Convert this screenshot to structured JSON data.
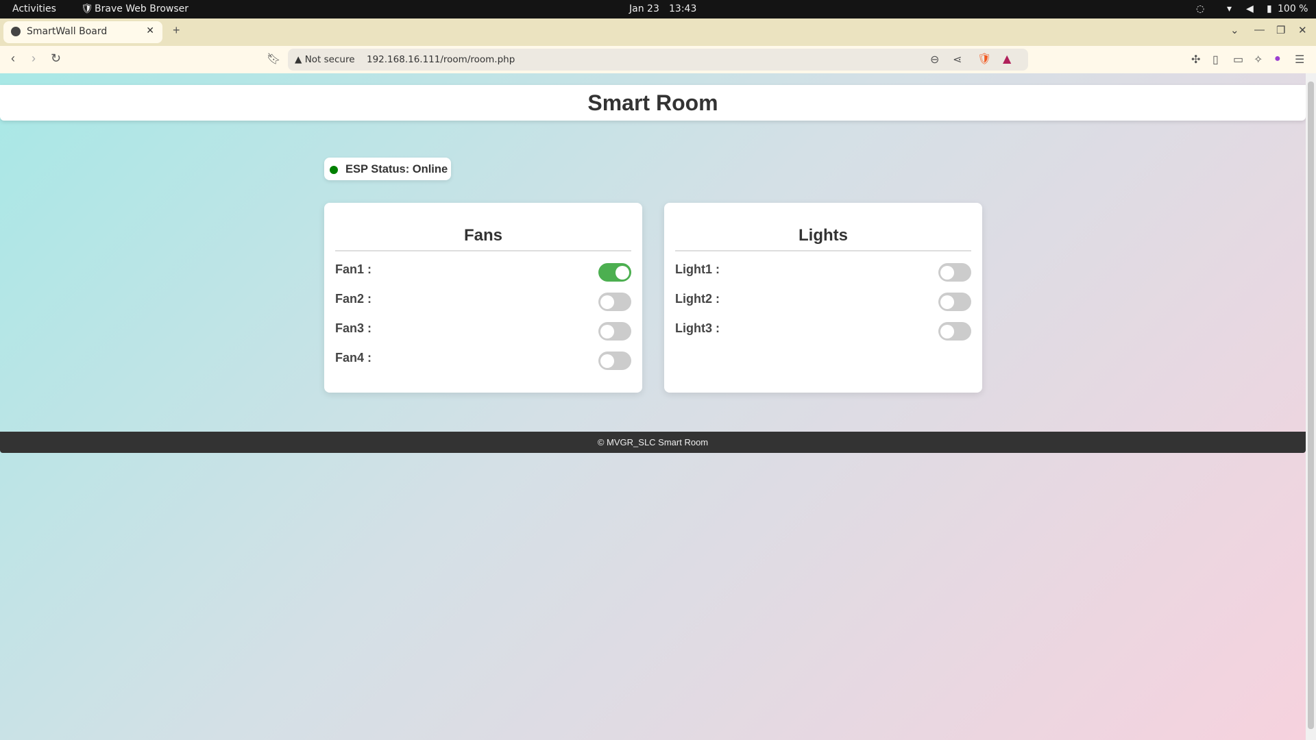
{
  "system": {
    "activities": "Activities",
    "app": "Brave Web Browser",
    "date": "Jan 23",
    "time": "13:43",
    "battery": "100 %"
  },
  "browser": {
    "tab_title": "SmartWall Board",
    "not_secure": "Not secure",
    "url": "192.168.16.111/room/room.php"
  },
  "page": {
    "title": "Smart Room",
    "status": {
      "label": "ESP Status: Online",
      "color": "#008000"
    },
    "cards": [
      {
        "title": "Fans",
        "devices": [
          {
            "label": "Fan1 :",
            "on": true
          },
          {
            "label": "Fan2 :",
            "on": false
          },
          {
            "label": "Fan3 :",
            "on": false
          },
          {
            "label": "Fan4 :",
            "on": false
          }
        ]
      },
      {
        "title": "Lights",
        "devices": [
          {
            "label": "Light1 :",
            "on": false
          },
          {
            "label": "Light2 :",
            "on": false
          },
          {
            "label": "Light3 :",
            "on": false
          }
        ]
      }
    ],
    "footer": "© MVGR_SLC Smart Room",
    "accent": "#4caf50"
  }
}
